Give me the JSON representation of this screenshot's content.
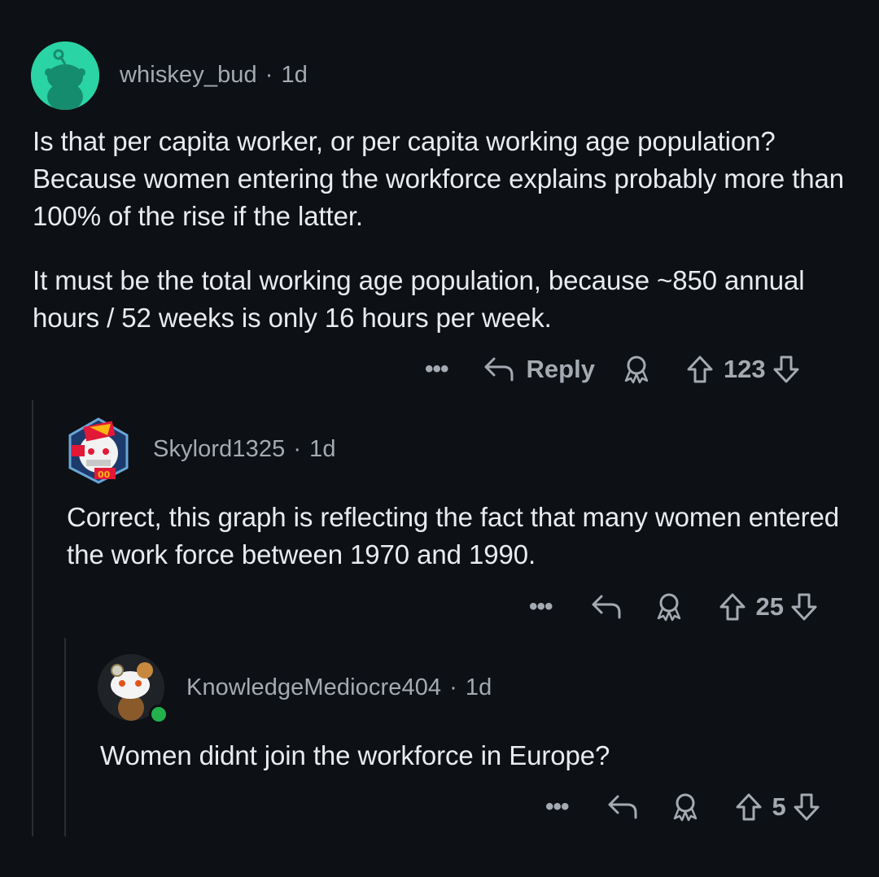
{
  "comments": [
    {
      "username": "whiskey_bud",
      "separator": "·",
      "age": "1d",
      "paragraphs": [
        "Is that per capita worker, or per capita working age population? Because women entering the workforce explains probably more than 100% of the rise if the latter.",
        "It must be the total working age population, because ~850 annual hours / 52 weeks is only 16 hours per week."
      ],
      "more_label": "•••",
      "reply_label": "Reply",
      "votes": "123",
      "avatar_color": "#2ad4a4"
    },
    {
      "username": "Skylord1325",
      "separator": "·",
      "age": "1d",
      "paragraphs": [
        "Correct, this graph is reflecting the fact that many women entered the work force between 1970 and 1990."
      ],
      "more_label": "•••",
      "votes": "25"
    },
    {
      "username": "KnowledgeMediocre404",
      "separator": "·",
      "age": "1d",
      "paragraphs": [
        "Women didnt join the workforce in Europe?"
      ],
      "more_label": "•••",
      "votes": "5",
      "online_color": "#22b14c"
    }
  ],
  "icons": {
    "more": "more-icon",
    "reply": "reply-arrow-icon",
    "award": "award-icon",
    "upvote": "upvote-icon",
    "downvote": "downvote-icon"
  },
  "colors": {
    "background": "#0d1014",
    "text": "#e9ebee",
    "meta": "#a4aab2",
    "thread_line": "#2a2e33"
  }
}
